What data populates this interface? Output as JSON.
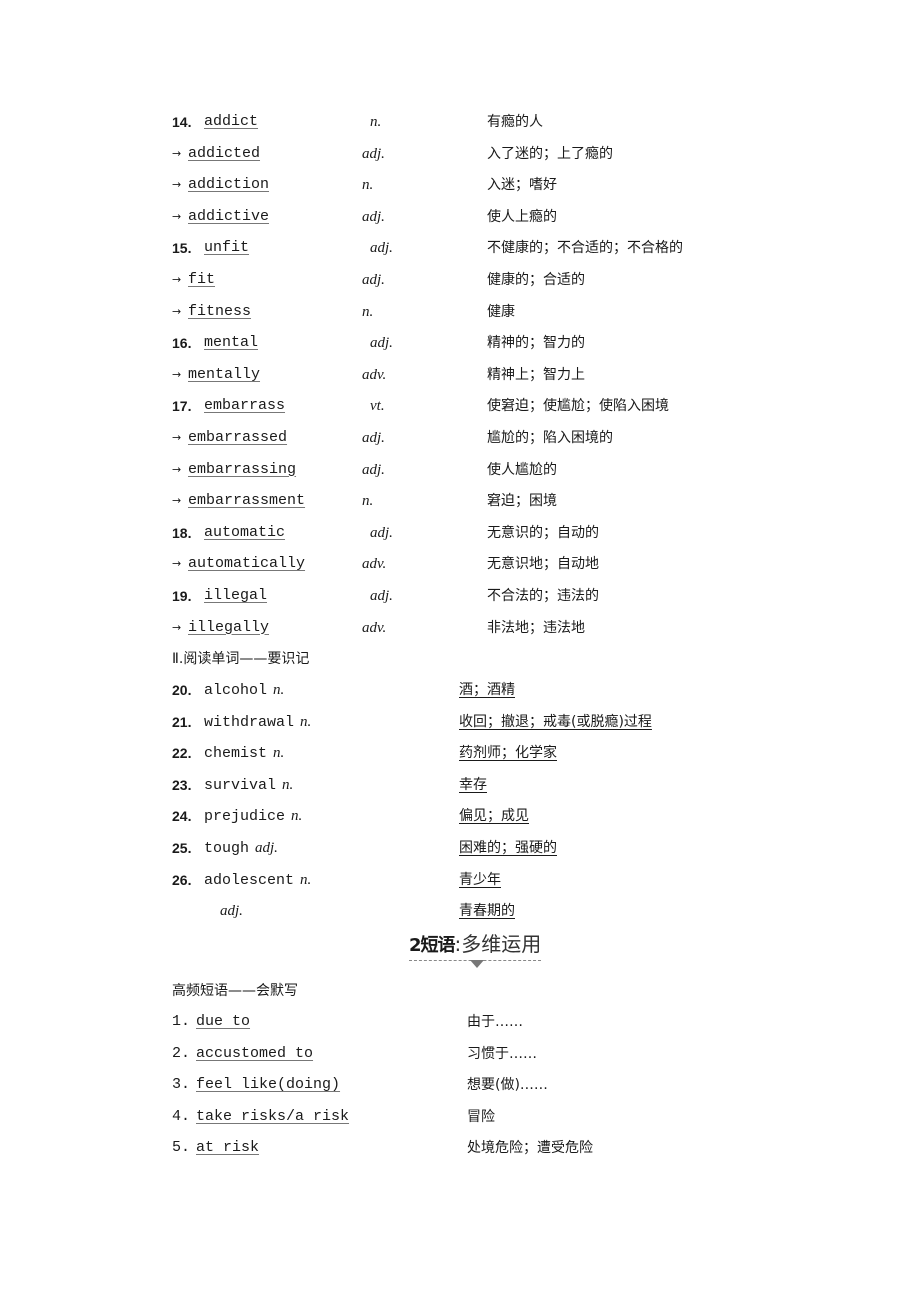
{
  "vocab_core": [
    {
      "num": "14.",
      "word": "addict",
      "pos": "n.",
      "meaning": "有瘾的人",
      "derived": false
    },
    {
      "arrow": "→",
      "word": "addicted",
      "pos": "adj.",
      "meaning": "入了迷的；上了瘾的",
      "derived": true
    },
    {
      "arrow": "→",
      "word": "addiction",
      "pos": "n.",
      "meaning": "入迷；嗜好",
      "derived": true
    },
    {
      "arrow": "→",
      "word": "addictive",
      "pos": "adj.",
      "meaning": "使人上瘾的",
      "derived": true
    },
    {
      "num": "15.",
      "word": "unfit",
      "pos": "adj.",
      "meaning": "不健康的；不合适的；不合格的",
      "derived": false
    },
    {
      "arrow": "→",
      "word": "fit",
      "pos": "adj.",
      "meaning": "健康的；合适的",
      "derived": true
    },
    {
      "arrow": "→",
      "word": "fitness",
      "pos": "n.",
      "meaning": "健康",
      "derived": true
    },
    {
      "num": "16.",
      "word": "mental",
      "pos": "adj.",
      "meaning": "精神的；智力的",
      "derived": false
    },
    {
      "arrow": "→",
      "word": "mentally",
      "pos": "adv.",
      "meaning": "精神上；智力上",
      "derived": true
    },
    {
      "num": "17.",
      "word": "embarrass",
      "pos": "vt.",
      "meaning": "使窘迫；使尴尬；使陷入困境",
      "derived": false
    },
    {
      "arrow": "→",
      "word": "embarrassed",
      "pos": "adj.",
      "meaning": "尴尬的；陷入困境的",
      "derived": true
    },
    {
      "arrow": "→",
      "word": "embarrassing",
      "pos": "adj.",
      "meaning": "使人尴尬的",
      "derived": true
    },
    {
      "arrow": "→",
      "word": "embarrassment",
      "pos": "n.",
      "meaning": "窘迫；困境",
      "derived": true
    },
    {
      "num": "18.",
      "word": "automatic",
      "pos": "adj.",
      "meaning": "无意识的；自动的",
      "derived": false
    },
    {
      "arrow": "→",
      "word": "automatically",
      "pos": "adv.",
      "meaning": "无意识地；自动地",
      "derived": true
    },
    {
      "num": "19.",
      "word": "illegal",
      "pos": "adj.",
      "meaning": "不合法的；违法的",
      "derived": false
    },
    {
      "arrow": "→",
      "word": "illegally",
      "pos": "adv.",
      "meaning": "非法地；违法地",
      "derived": true
    }
  ],
  "reading_section": {
    "heading": "Ⅱ.阅读单词——要识记",
    "items": [
      {
        "num": "20.",
        "word": "alcohol",
        "pos": "n.",
        "meaning": "酒；酒精"
      },
      {
        "num": "21.",
        "word": "withdrawal",
        "pos": "n.",
        "meaning": "收回；撤退；戒毒(或脱瘾)过程"
      },
      {
        "num": "22.",
        "word": "chemist",
        "pos": "n.",
        "meaning": "药剂师；化学家"
      },
      {
        "num": "23.",
        "word": "survival",
        "pos": "n.",
        "meaning": "幸存"
      },
      {
        "num": "24.",
        "word": "prejudice",
        "pos": "n.",
        "meaning": "偏见；成见"
      },
      {
        "num": "25.",
        "word": "tough",
        "pos": "adj.",
        "meaning": "困难的；强硬的"
      },
      {
        "num": "26.",
        "word": "adolescent",
        "pos": "n.",
        "meaning": "青少年"
      },
      {
        "num": "",
        "word": "",
        "pos": "adj.",
        "meaning": "青春期的"
      }
    ]
  },
  "banner": {
    "bold": "2短语",
    "separator": ":",
    "light": "多维运用"
  },
  "phrase_section": {
    "heading": "高频短语——会默写",
    "items": [
      {
        "num": "1.",
        "phrase": "due to",
        "meaning": "由于……"
      },
      {
        "num": "2.",
        "phrase": "accustomed to",
        "meaning": "习惯于……"
      },
      {
        "num": "3.",
        "phrase": "feel like(doing)",
        "meaning": "想要(做)……"
      },
      {
        "num": "4.",
        "phrase": "take risks/a risk",
        "meaning": "冒险"
      },
      {
        "num": "5.",
        "phrase": "at risk",
        "meaning": "处境危险；遭受危险"
      }
    ]
  }
}
